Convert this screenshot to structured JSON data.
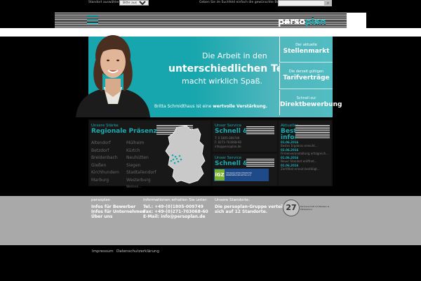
{
  "topbar": {
    "location_label": "Standort auswählen:",
    "location_value": "Bitte auswählen",
    "search_label": "Geben Sie im Suchfeld einfach die gewünschte Berufsbezeichnung ein:",
    "search_value": "",
    "search_button_icon": "search-icon"
  },
  "logo": {
    "part1": "perso",
    "part2": "plan"
  },
  "hero": {
    "line1": "Die Arbeit in den",
    "line2": "unterschiedlichen Teams",
    "line3": "macht wirklich Spaß.",
    "caption_name": "Britta Schmidthaus ist eine",
    "caption_bold": "wertvolle Verstärkung."
  },
  "quicklinks": [
    {
      "small": "Der aktuelle",
      "big": "Stellenmarkt"
    },
    {
      "small": "Die derzeit gültigen",
      "big": "Tarifverträge"
    },
    {
      "small": "Schnell zur",
      "big": "Direktbewerbung"
    }
  ],
  "strength": {
    "small": "Unsere Stärke",
    "big": "Regionale Präsenz",
    "cities_left": [
      "Altendorf",
      "Betzdorf",
      "Breidenbach",
      "Gießen",
      "Kirchhundem",
      "Marburg"
    ],
    "cities_right": [
      "Mülheim",
      "Kürtch",
      "Neuhütten",
      "Siegen",
      "Stadtallendorf",
      "Westerburg"
    ],
    "more": "Weitere..."
  },
  "service1": {
    "small": "Unser Service",
    "big": "Schnell & direkt",
    "lines": [
      "T: 0 1805-009749",
      "F: 0271-703068-60",
      "info@persoplan.de"
    ]
  },
  "service2": {
    "small": "Unser Service",
    "big": "Schnell & direkt",
    "badge_left": "iGZ",
    "badge_right": "Interessenverband Deutscher Zeitarbeitsunternehmen e.V."
  },
  "news": {
    "small": "Aktuelles",
    "big1": "Bestens",
    "big2": "informiert",
    "items": [
      {
        "date": "01.06.2016",
        "text": "Bestes Ergebnis erreicht..."
      },
      {
        "date": "02.06.2016",
        "text": "Firmenveranstaltung erfolgreich..."
      },
      {
        "date": "01.06.2016",
        "text": "Neuer Standort eröffnet..."
      },
      {
        "date": "01.06.2016",
        "text": "Zertifikat erneut bestätigt..."
      }
    ]
  },
  "footer": {
    "col1_head": "persoplan",
    "col1_lines": [
      "Infos für Bewerber",
      "Infos für Unternehmen",
      "Über uns"
    ],
    "col2_head": "Informationen erhalten Sie unter:",
    "col2_lines": [
      "Tel.: +49-(0)1805-009749",
      "Fax: +49-(0)271-703068-60",
      "E-Mail: info@persoplan.de"
    ],
    "col3_head": "Unsere Standorte:",
    "col3_lines": [
      "Die persoplan-Gruppe verteilt",
      "sich auf 12 Standorte."
    ],
    "award_number": "27",
    "award_text": "Partnerschaft mit Banken & Mittelstand"
  },
  "bottom": {
    "impressum": "Impressum",
    "datenschutz": "Datenschutzerklärung"
  },
  "colors": {
    "teal": "#17a6ad",
    "gray": "#a9a9a9"
  }
}
